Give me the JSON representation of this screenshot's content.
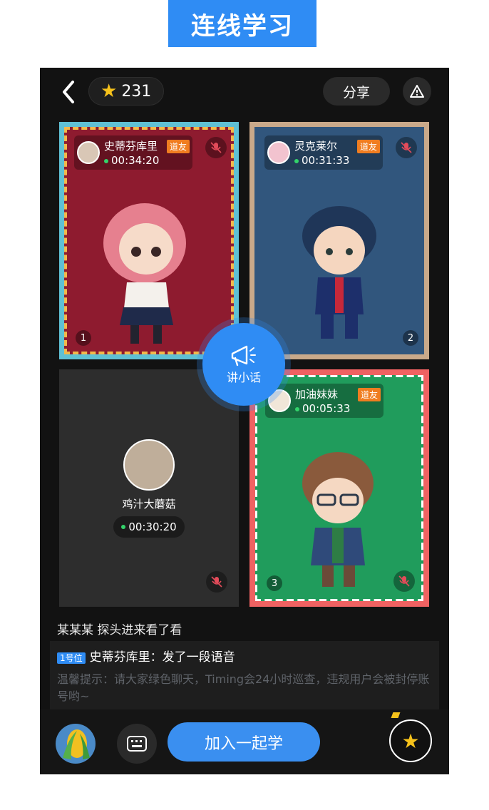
{
  "banner": {
    "title": "连线学习"
  },
  "header": {
    "stars": "231",
    "share_label": "分享"
  },
  "seats": [
    {
      "name": "史蒂芬库里",
      "tag": "道友",
      "time": "00:34:20",
      "number": "1"
    },
    {
      "name": "灵克莱尔",
      "tag": "道友",
      "time": "00:31:33",
      "number": "2"
    },
    {
      "name": "鸡汁大蘑菇",
      "time": "00:30:20"
    },
    {
      "name": "加油妹妹",
      "tag": "道友",
      "time": "00:05:33",
      "number": "3"
    }
  ],
  "speak_button": {
    "label": "讲小话"
  },
  "feed": {
    "activity": "某某某 探头进来看了看",
    "message": {
      "badge": "1号位",
      "sender": "史蒂芬库里：",
      "text": "发了一段语音"
    },
    "tip": "温馨提示：请大家绿色聊天，Timing会24小时巡查，违规用户会被封停账号哟~"
  },
  "bottom": {
    "join_label": "加入一起学"
  },
  "colors": {
    "accent": "#2f8cf4",
    "star": "#f6c21b",
    "badge": "#f07d20"
  }
}
